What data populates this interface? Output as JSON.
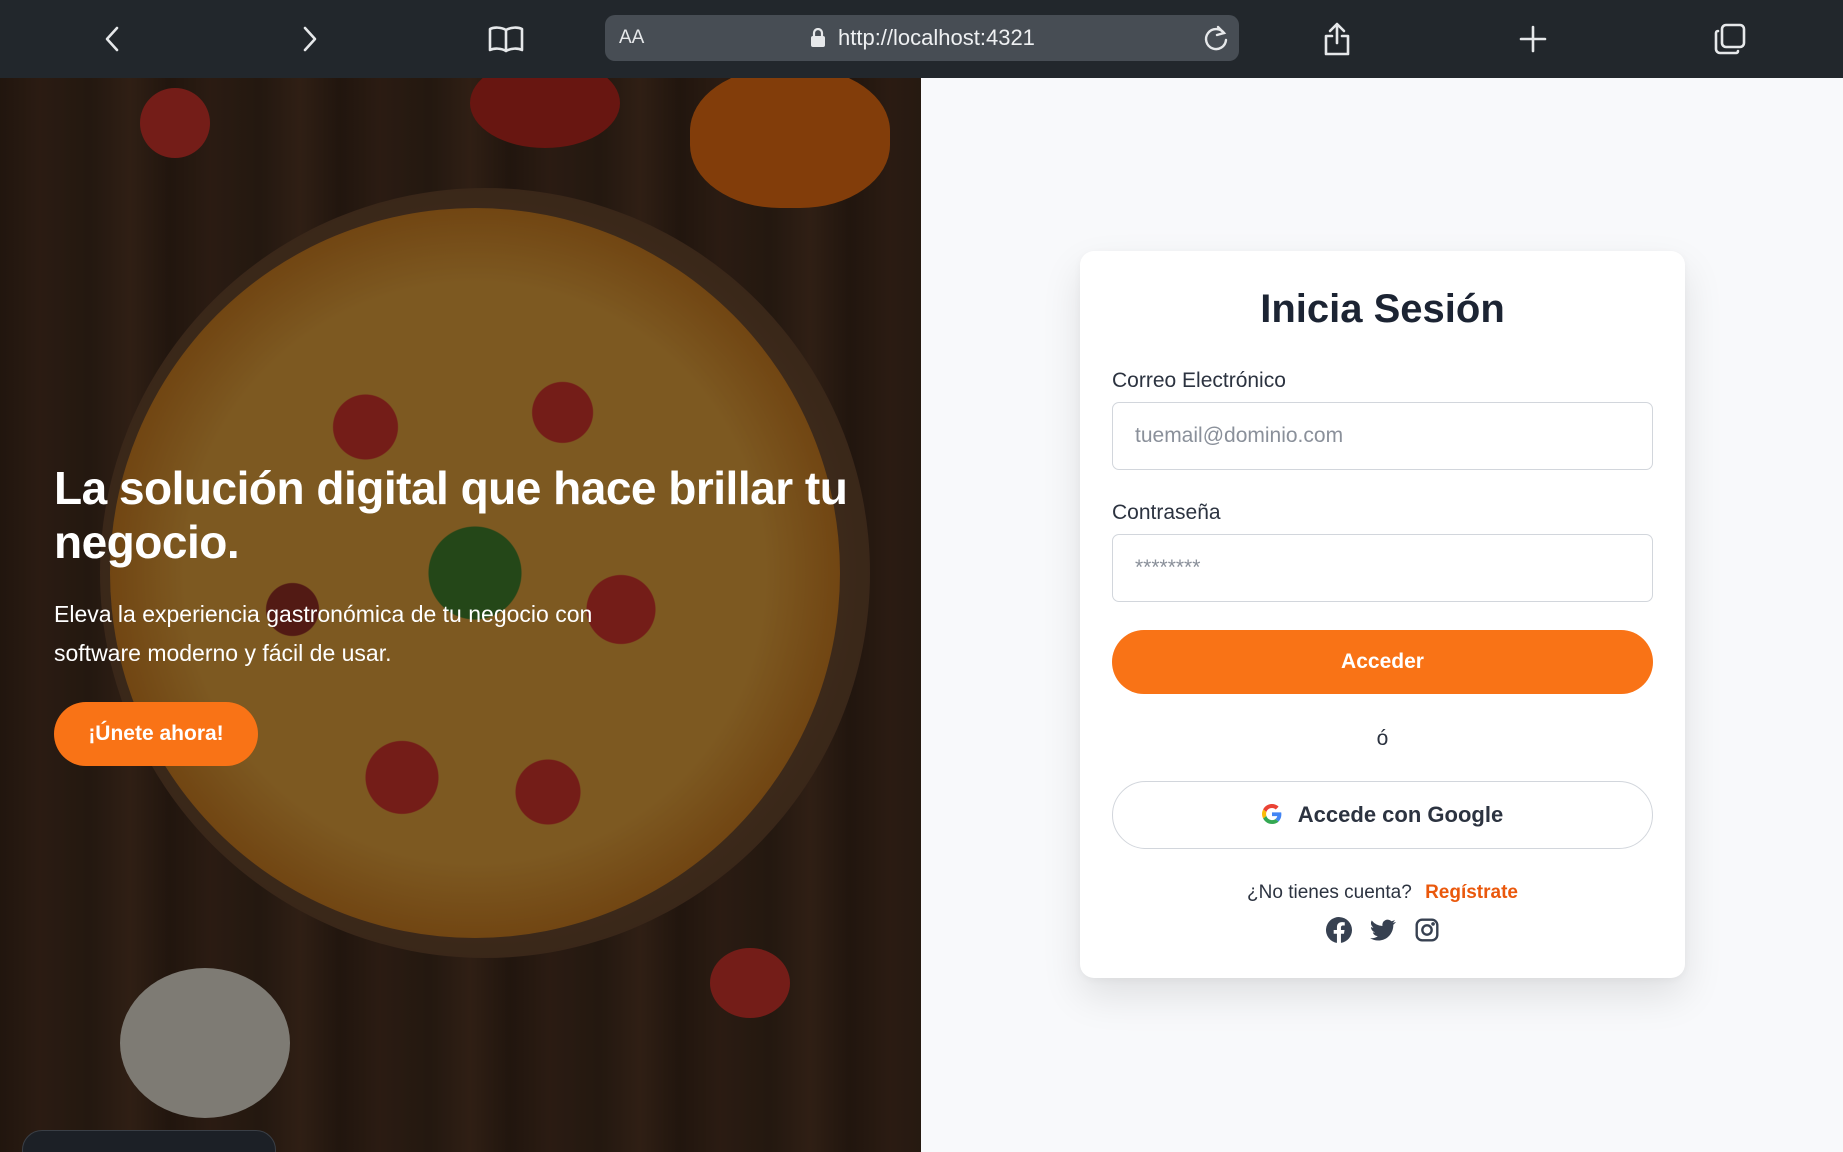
{
  "browser": {
    "aa_label": "AA",
    "url": "http://localhost:4321",
    "icons": [
      "back-icon",
      "forward-icon",
      "bookmarks-icon",
      "lock-icon",
      "reload-icon",
      "share-icon",
      "new-tab-icon",
      "tabs-icon"
    ]
  },
  "hero": {
    "title": "La solución digital que hace brillar tu negocio.",
    "subtitle": "Eleva la experiencia gastronómica de tu negocio con software moderno y fácil de usar.",
    "cta_label": "¡Únete ahora!"
  },
  "login": {
    "title": "Inicia Sesión",
    "email_label": "Correo Electrónico",
    "email_placeholder": "tuemail@dominio.com",
    "email_value": "",
    "password_label": "Contraseña",
    "password_placeholder": "********",
    "password_value": "",
    "submit_label": "Acceder",
    "divider": "ó",
    "google_label": "Accede con Google",
    "signup_prompt": "¿No tienes cuenta?",
    "signup_link": "Regístrate",
    "social_icons": [
      "facebook-icon",
      "twitter-icon",
      "instagram-icon"
    ]
  },
  "colors": {
    "accent": "#f97316",
    "link": "#ea580c",
    "toolbar_bg": "#22272c",
    "page_bg": "#f8f9fb",
    "title": "#1c2433"
  }
}
